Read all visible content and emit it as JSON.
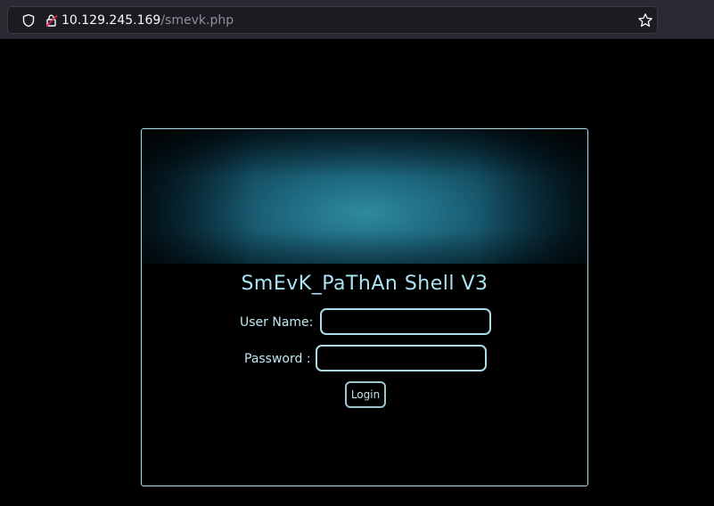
{
  "browser": {
    "url_host": "10.129.245.169",
    "url_path": "/smevk.php",
    "icons": {
      "shield": "shield-icon",
      "lock": "lock-warning-icon",
      "bookmark": "star-icon"
    }
  },
  "panel": {
    "title": "SmEvK_PaThAn Shell V3",
    "username_label": "User Name:",
    "username_value": "",
    "password_label": "Password :",
    "password_value": "",
    "login_label": "Login"
  },
  "colors": {
    "accent": "#a8dde9",
    "title": "#a8e4f2",
    "background": "#000000",
    "banner": "#1f6b82"
  }
}
